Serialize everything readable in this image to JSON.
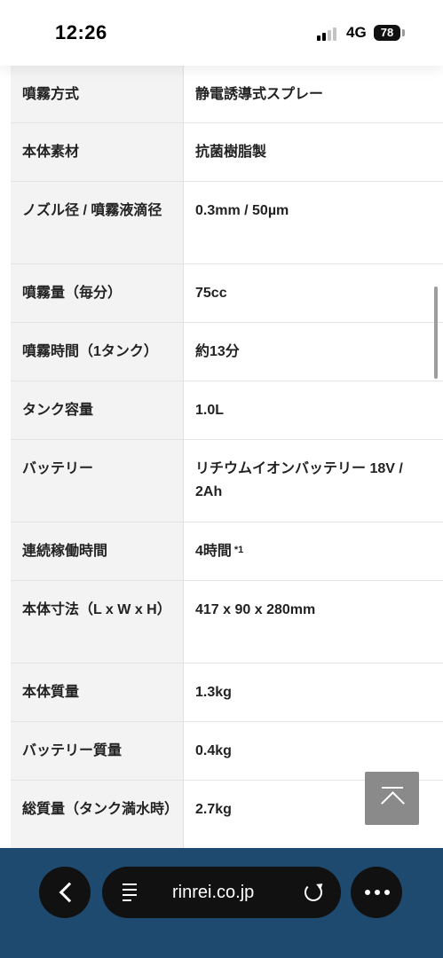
{
  "status_bar": {
    "time": "12:26",
    "network": "4G",
    "battery": "78"
  },
  "specs": [
    {
      "label": "噴霧方式",
      "value": "静電誘導式スプレー"
    },
    {
      "label": "本体素材",
      "value": "抗菌樹脂製"
    },
    {
      "label": "ノズル径 / 噴霧液滴径",
      "value": "0.3mm / 50µm"
    },
    {
      "label": "噴霧量（毎分）",
      "value": "75cc"
    },
    {
      "label": "噴霧時間（1タンク）",
      "value": "約13分"
    },
    {
      "label": "タンク容量",
      "value": "1.0L"
    },
    {
      "label": "バッテリー",
      "value": "リチウムイオンバッテリー 18V / 2Ah"
    },
    {
      "label": "連続稼働時間",
      "value": "4時間",
      "note": "*1"
    },
    {
      "label": "本体寸法（L x W x H）",
      "value": "417 x 90 x 280mm"
    },
    {
      "label": "本体質量",
      "value": "1.3kg"
    },
    {
      "label": "バッテリー質量",
      "value": "0.4kg"
    },
    {
      "label": "総質量（タンク満水時）",
      "value": "2.7kg"
    }
  ],
  "browser": {
    "url": "rinrei.co.jp"
  },
  "icons": {
    "back": "back-chevron-icon",
    "reader": "reader-mode-icon",
    "reload": "reload-icon",
    "more": "more-dots-icon",
    "to_top": "scroll-to-top-icon"
  },
  "colors": {
    "browser_bar": "#1e4a70",
    "label_bg": "#f3f3f3",
    "to_top_button": "#8a8a8a"
  }
}
